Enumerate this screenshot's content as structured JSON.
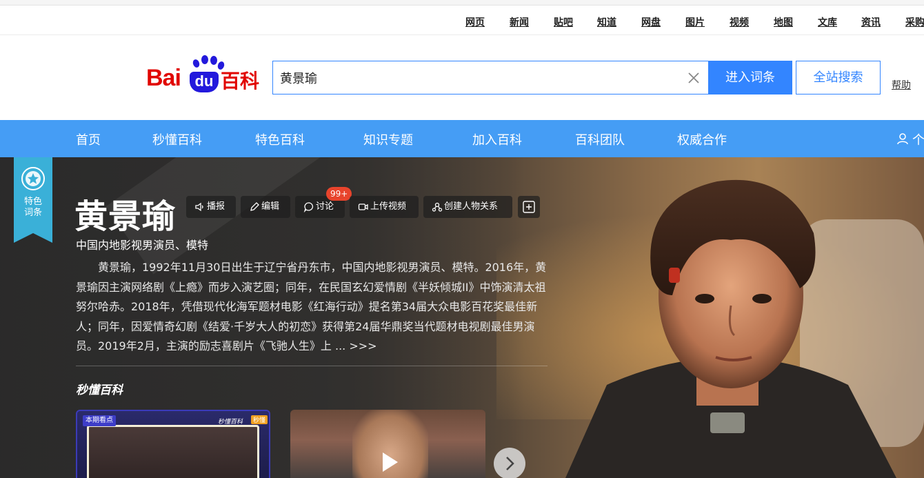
{
  "topnav": {
    "links": [
      "网页",
      "新闻",
      "贴吧",
      "知道",
      "网盘",
      "图片",
      "视频",
      "地图",
      "文库",
      "资讯",
      "采购"
    ]
  },
  "header": {
    "logo_bai": "Bai",
    "logo_du": "du",
    "logo_baike": "百科",
    "search_value": "黄景瑜",
    "enter_button": "进入词条",
    "all_search_button": "全站搜索",
    "help": "帮助"
  },
  "bluenav": {
    "items": [
      "首页",
      "秒懂百科",
      "特色百科",
      "知识专题",
      "加入百科",
      "百科团队",
      "权威合作"
    ],
    "user_label": "个"
  },
  "hero": {
    "ribbon_line1": "特色",
    "ribbon_line2": "词条",
    "title": "黄景瑜",
    "tools": [
      "播报",
      "编辑",
      "讨论",
      "上传视频",
      "创建人物关系"
    ],
    "discuss_badge": "99+",
    "subtitle": "中国内地影视男演员、模特",
    "summary": "黄景瑜，1992年11月30日出生于辽宁省丹东市，中国内地影视男演员、模特。2016年，黄景瑜因主演网络剧《上瘾》而步入演艺圈；同年，在民国玄幻爱情剧《半妖倾城II》中饰演清太祖努尔哈赤。2018年，凭借现代化海军题材电影《红海行动》提名第34届大众电影百花奖最佳新人；同年，因爱情奇幻剧《结爱·千岁大人的初恋》获得第24届华鼎奖当代题材电视剧最佳男演员。2019年2月，主演的励志喜剧片《飞驰人生》上 ...",
    "more": ">>>",
    "miaodong": "秒懂百科",
    "card1_tag": "本期看点",
    "card1_brand": "秒懂百科",
    "card1_badge": "秒懂"
  },
  "colors": {
    "accent_blue": "#3385ff",
    "nav_blue": "#459df5",
    "brand_red": "#e10602",
    "badge_red": "#e8442c",
    "ribbon": "#3ab0d8"
  }
}
